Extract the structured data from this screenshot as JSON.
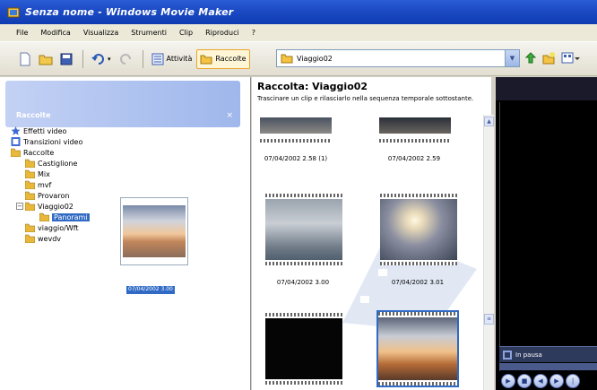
{
  "window": {
    "title": "Senza nome - Windows Movie Maker"
  },
  "menu": [
    "File",
    "Modifica",
    "Visualizza",
    "Strumenti",
    "Clip",
    "Riproduci",
    "?"
  ],
  "toolbar": {
    "activity_label": "Attività",
    "collections_label": "Raccolte",
    "collection_combo_value": "Viaggio02"
  },
  "left_panel": {
    "header": "Raccolte",
    "tree": [
      {
        "label": "Effetti video",
        "icon": "effects-star-icon"
      },
      {
        "label": "Transizioni video",
        "icon": "transition-icon"
      },
      {
        "label": "Raccolte",
        "icon": "folder-icon"
      },
      {
        "label": "Castiglione",
        "icon": "folder-icon"
      },
      {
        "label": "Mix",
        "icon": "folder-icon"
      },
      {
        "label": "mvf",
        "icon": "folder-icon"
      },
      {
        "label": "Provaron",
        "icon": "folder-icon"
      },
      {
        "label": "Viaggio02",
        "icon": "folder-icon"
      },
      {
        "label": "Panorami",
        "icon": "folder-icon"
      },
      {
        "label": "viaggio/Wft",
        "icon": "folder-icon"
      },
      {
        "label": "wevdv",
        "icon": "folder-icon"
      }
    ],
    "drag_label": "07/04/2002 3.00"
  },
  "mid_panel": {
    "title": "Raccolta: Viaggio02",
    "subtitle": "Trascinare un clip e rilasciarlo nella sequenza temporale sottostante.",
    "clips": [
      {
        "label": "07/04/2002 2.58 (1)",
        "thumb": "sky"
      },
      {
        "label": "07/04/2002 2.59",
        "thumb": "sea"
      },
      {
        "label": "07/04/2002 3.00",
        "thumb": "fog"
      },
      {
        "label": "07/04/2002 3.01",
        "thumb": "sunset"
      },
      {
        "label": "",
        "thumb": "black"
      },
      {
        "label": "",
        "thumb": "clouds"
      }
    ]
  },
  "preview": {
    "status": "In pausa"
  },
  "colors": {
    "title_bar": "#1d4cc6",
    "selection": "#316ac5",
    "panel_header": "#9fb7ec"
  }
}
